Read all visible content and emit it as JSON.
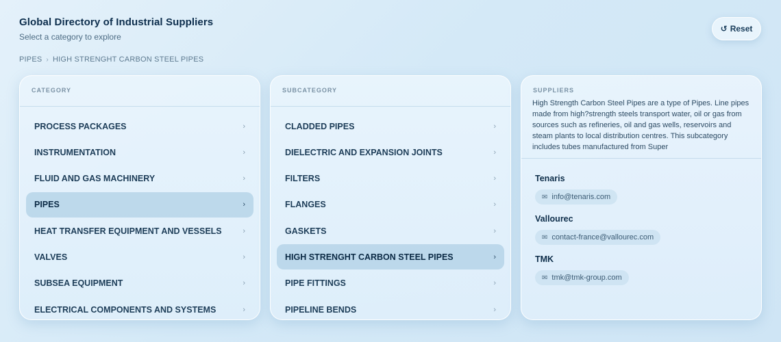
{
  "header": {
    "title": "Global Directory of Industrial Suppliers",
    "subtitle": "Select a category to explore",
    "reset_label": "Reset",
    "reset_icon": "↺"
  },
  "breadcrumb": {
    "items": [
      "PIPES",
      "HIGH STRENGHT CARBON STEEL PIPES"
    ],
    "separator": "›"
  },
  "category_panel": {
    "heading": "CATEGORY",
    "items": [
      "PROCESS PACKAGES",
      "INSTRUMENTATION",
      "FLUID AND GAS MACHINERY",
      "PIPES",
      "HEAT TRANSFER EQUIPMENT AND VESSELS",
      "VALVES",
      "SUBSEA EQUIPMENT",
      "ELECTRICAL COMPONENTS AND SYSTEMS"
    ],
    "selected": "PIPES"
  },
  "subcategory_panel": {
    "heading": "SUBCATEGORY",
    "items": [
      "CLADDED PIPES",
      "DIELECTRIC AND EXPANSION JOINTS",
      "FILTERS",
      "FLANGES",
      "GASKETS",
      "HIGH STRENGHT CARBON STEEL PIPES",
      "PIPE FITTINGS",
      "PIPELINE BENDS"
    ],
    "selected": "HIGH STRENGHT CARBON STEEL PIPES"
  },
  "chevron": "›",
  "suppliers_panel": {
    "heading": "SUPPLIERS",
    "description": "High Strength Carbon Steel Pipes are a type of Pipes. Line pipes made from high?strength steels transport water, oil or gas from sources such as refineries, oil and gas wells, reservoirs and steam plants to local distribution centres. This subcategory includes tubes manufactured from Super",
    "suppliers": [
      {
        "name": "Tenaris",
        "email": "info@tenaris.com"
      },
      {
        "name": "Vallourec",
        "email": "contact-france@vallourec.com"
      },
      {
        "name": "TMK",
        "email": "tmk@tmk-group.com"
      }
    ]
  },
  "colors": {
    "accent_selected": "#b0d0e5",
    "title": "#0d2e4d"
  }
}
